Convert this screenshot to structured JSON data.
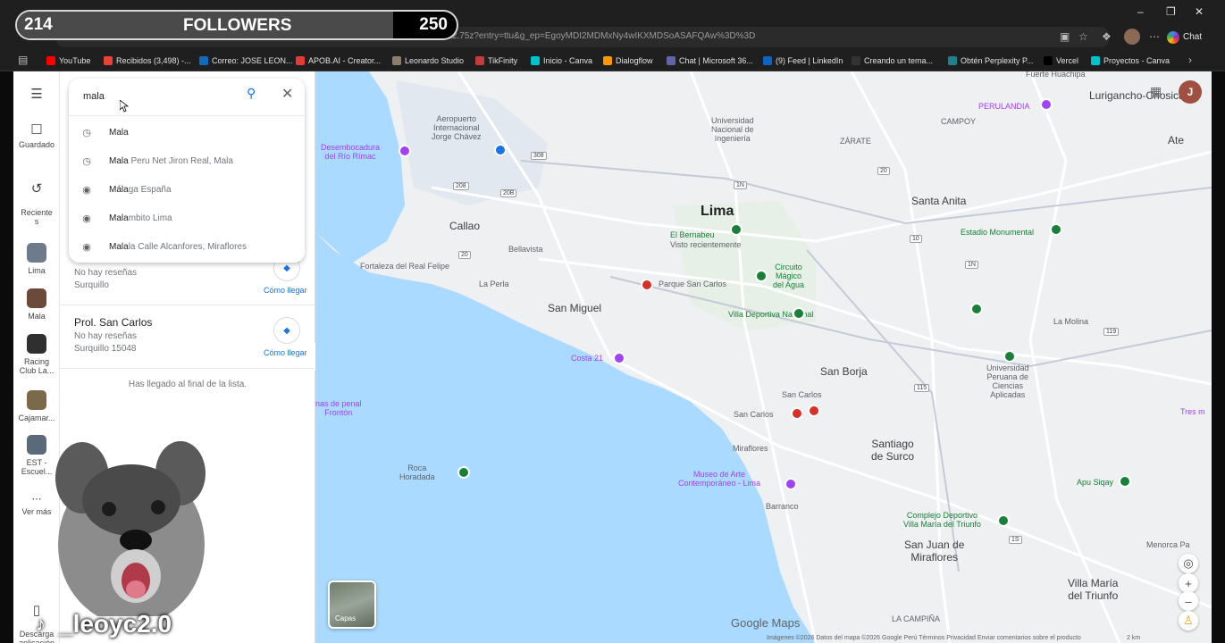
{
  "overlay": {
    "followers_current": "214",
    "followers_label": "FOLLOWERS",
    "followers_goal": "250",
    "progress_fraction": 0.856,
    "handle": "_leoyc2.0"
  },
  "browser": {
    "url": "...12.75z?entry=ttu&g_ep=EgoyMDI2MDMxNy4wIKXMDSoASAFQAw%3D%3D",
    "chat_label": "Chat",
    "bookmarks": [
      {
        "label": "YouTube",
        "color": "#ff0000"
      },
      {
        "label": "Recibidos (3,498) -...",
        "color": "#ea4335"
      },
      {
        "label": "Correo: JOSE LEON...",
        "color": "#0f6cbd"
      },
      {
        "label": "APOB.AI - Creator...",
        "color": "#e53935"
      },
      {
        "label": "Leonardo Studio",
        "color": "#8a7f6f"
      },
      {
        "label": "TikFinity",
        "color": "#c43b3b"
      },
      {
        "label": "Inicio - Canva",
        "color": "#00c4cc"
      },
      {
        "label": "Dialogflow",
        "color": "#ff9800"
      },
      {
        "label": "Chat | Microsoft 36...",
        "color": "#6264a7"
      },
      {
        "label": "(9) Feed | LinkedIn",
        "color": "#0a66c2"
      },
      {
        "label": "Creando un tema...",
        "color": "#333333"
      },
      {
        "label": "Obtén Perplexity P...",
        "color": "#20808d"
      },
      {
        "label": "Vercel",
        "color": "#000000"
      },
      {
        "label": "Proyectos - Canva",
        "color": "#00c4cc"
      }
    ]
  },
  "rail": {
    "menu_icon": "menu-icon",
    "saved": "Guardado",
    "recent": "Reciente\ns",
    "recents": [
      {
        "label": "Lima",
        "color": "#6d7b8a"
      },
      {
        "label": "Mala",
        "color": "#6b4a3c"
      },
      {
        "label": "Racing\nClub La...",
        "color": "#2f2f2f"
      },
      {
        "label": "Cajamar...",
        "color": "#7a6a4a"
      },
      {
        "label": "EST -\nEscuel...",
        "color": "#5a6a7a"
      }
    ],
    "more": "Ver más",
    "download": "Descarga\naplicación"
  },
  "search": {
    "value": "mala",
    "suggestions": [
      {
        "icon": "history-icon",
        "bold": "Mala",
        "rest": ""
      },
      {
        "icon": "history-icon",
        "bold": "Mala",
        "rest": " Peru Net Jiron Real, Mala"
      },
      {
        "icon": "place-icon",
        "bold": "Mála",
        "rest": "ga España"
      },
      {
        "icon": "place-icon",
        "bold": "Mala",
        "rest": "mbito Lima"
      },
      {
        "icon": "place-icon",
        "bold": "Mala",
        "rest": "la Calle Alcanfores, Miraflores"
      }
    ]
  },
  "results": [
    {
      "title": "",
      "rating": "No hay reseñas",
      "address": "Surquillo",
      "directions": "Cómo llegar"
    },
    {
      "title": "Prol. San Carlos",
      "rating": "No hay reseñas",
      "address": "Surquillo 15048",
      "directions": "Cómo llegar"
    }
  ],
  "end_of_list": "Has llegado al final de la lista.",
  "map": {
    "labels": {
      "lurigancho": "Lurigancho-Chosica",
      "huachipa": "Fuerte Huachipa",
      "perulandia": "PERULANDIA",
      "campoy": "CAMPOY",
      "ate": "Ate",
      "zarate": "ZÁRATE",
      "uni": "Universidad\nNacional de\nIngeniería",
      "desembocadura": "Desembocadura\ndel Río Rímac",
      "aeropuerto": "Aeropuerto\nInternacional\nJorge Chávez",
      "lima": "Lima",
      "santa_anita": "Santa Anita",
      "callao": "Callao",
      "el_bernabeu": "El Bernabeu",
      "visto": "Visto recientemente",
      "estadio": "Estadio Monumental",
      "bellavista": "Bellavista",
      "fortaleza": "Fortaleza del Real Felipe",
      "la_perla": "La Perla",
      "parque_san_carlos": "Parque San Carlos",
      "circuito": "Circuito\nMágico\ndel Agua",
      "san_miguel": "San Miguel",
      "villa_deportiva": "Villa Deportiva Nacional",
      "la_molina": "La Molina",
      "costa21": "Costa 21",
      "san_borja": "San Borja",
      "upc": "Universidad\nPeruana de\nCiencias\nAplicadas",
      "san_carlos": "San Carlos",
      "san_carlos2": "San Carlos",
      "tres": "Tres m",
      "penal": "nas de penal\nFrontón",
      "miraflores": "Miraflores",
      "surco": "Santiago\nde Surco",
      "roca": "Roca\nHoradada",
      "mac": "Museo de Arte\nContemporáneo - Lima",
      "apu": "Apu Siqay",
      "barranco": "Barranco",
      "complejo": "Complejo Deportivo\nVilla María del Triunfo",
      "sjm": "San Juan de\nMiraflores",
      "menorca": "Menorca Pa",
      "vmt": "Villa María\ndel Triunfo",
      "la_campina": "LA CAMPIÑA"
    },
    "roads": [
      "308",
      "208",
      "20B",
      "20",
      "1N",
      "20",
      "10",
      "1N",
      "119",
      "115",
      "1S"
    ],
    "layers": "Capas",
    "logo": "Google Maps",
    "footer": "Imágenes ©2026   Datos del mapa ©2026 Google   Perú   Términos   Privacidad   Enviar comentarios sobre el producto",
    "scale": "2 km",
    "avatar": "J",
    "colors": {
      "water": "#aadaff",
      "land": "#eef0f2",
      "green": "#188038",
      "pink": "#a142f4",
      "red": "#d93025"
    }
  }
}
